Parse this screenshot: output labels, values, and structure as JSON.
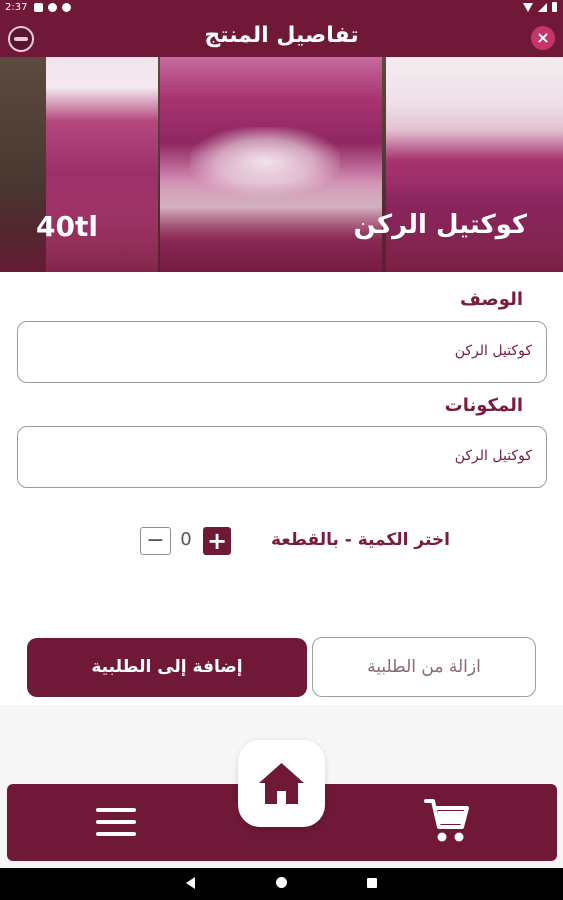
{
  "status_bar": {
    "time": "2:37"
  },
  "app_bar": {
    "title": "تفاصيل المنتج",
    "close_icon": "close-icon",
    "logo_icon": "restaurant-logo"
  },
  "product": {
    "name": "كوكتيل الركن",
    "price": "40tl"
  },
  "description": {
    "label": "الوصف",
    "value": "كوكتيل الركن"
  },
  "ingredients": {
    "label": "المكونات",
    "value": "كوكتيل الركن"
  },
  "quantity": {
    "label": "اختر الكمية - بالقطعة",
    "value": "0",
    "plus": "+",
    "minus": "−"
  },
  "actions": {
    "add_label": "إضافة إلى الطلبية",
    "remove_label": "ازالة من الطلبية"
  },
  "bottom_nav": {
    "home_icon": "home-icon",
    "menu_icon": "menu-icon",
    "cart_icon": "cart-icon"
  },
  "colors": {
    "primary": "#6f1838",
    "accent": "#c4366a",
    "text": "#7a1c42"
  }
}
